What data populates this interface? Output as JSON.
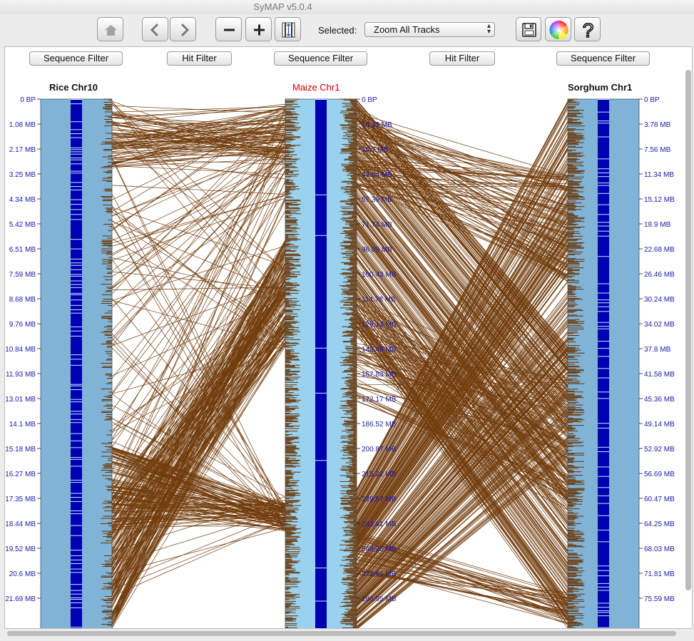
{
  "window": {
    "title": "SyMAP v5.0.4"
  },
  "toolbar": {
    "buttons": [
      {
        "name": "home-button",
        "icon": "home-icon"
      },
      {
        "name": "back-button",
        "icon": "chevron-left-icon"
      },
      {
        "name": "forward-button",
        "icon": "chevron-right-icon"
      },
      {
        "name": "zoom-out-button",
        "icon": "minus-icon"
      },
      {
        "name": "zoom-in-button",
        "icon": "plus-icon"
      },
      {
        "name": "fit-track-button",
        "icon": "fit-track-icon"
      },
      {
        "name": "save-button",
        "icon": "floppy-disk-icon"
      },
      {
        "name": "color-button",
        "icon": "color-wheel-icon"
      },
      {
        "name": "help-button",
        "icon": "question-mark-icon"
      }
    ],
    "selected_label": "Selected:",
    "selected_value": "Zoom All Tracks"
  },
  "filters": {
    "seq1": "Sequence Filter",
    "hit1": "Hit Filter",
    "seq2": "Sequence Filter",
    "hit2": "Hit Filter",
    "seq3": "Sequence Filter"
  },
  "tracks": [
    {
      "title": "Rice Chr10",
      "title_color": "#111111",
      "ruler_side": "left",
      "ticks": [
        "0 BP",
        "1.08 MB",
        "2.17 MB",
        "3.25 MB",
        "4.34 MB",
        "5.42 MB",
        "6.51 MB",
        "7.59 MB",
        "8.68 MB",
        "9.76 MB",
        "10.84 MB",
        "11.93 MB",
        "13.01 MB",
        "14.1 MB",
        "15.18 MB",
        "16.27 MB",
        "17.35 MB",
        "18.44 MB",
        "19.52 MB",
        "20.6 MB",
        "21.69 MB"
      ]
    },
    {
      "title": "Maize Chr1",
      "title_color": "#cc0000",
      "ruler_side": "right",
      "ticks": [
        "0 BP",
        "14.35 MB",
        "28.7 MB",
        "43.04 MB",
        "57.39 MB",
        "71.74 MB",
        "86.09 MB",
        "100.43 MB",
        "114.78 MB",
        "129.13 MB",
        "143.48 MB",
        "157.83 MB",
        "172.17 MB",
        "186.52 MB",
        "200.87 MB",
        "215.22 MB",
        "229.57 MB",
        "243.91 MB",
        "258.26 MB",
        "272.61 MB",
        "286.95 MB"
      ]
    },
    {
      "title": "Sorghum Chr1",
      "title_color": "#111111",
      "ruler_side": "right",
      "ticks": [
        "0 BP",
        "3.78 MB",
        "7.56 MB",
        "11.34 MB",
        "15.12 MB",
        "18.9 MB",
        "22.68 MB",
        "26.46 MB",
        "30.24 MB",
        "34.02 MB",
        "37.8 MB",
        "41.58 MB",
        "45.36 MB",
        "49.14 MB",
        "52.92 MB",
        "56.69 MB",
        "60.47 MB",
        "64.25 MB",
        "68.03 MB",
        "71.81 MB",
        "75.59 MB"
      ]
    }
  ],
  "colors": {
    "track_rice": "#80b3d6",
    "track_maize": "#99d1ee",
    "track_sorghum": "#80b3d6",
    "gene_band": "#0000b3",
    "hit_line": "#6b3300",
    "ruler_text": "#1a1aa8"
  }
}
